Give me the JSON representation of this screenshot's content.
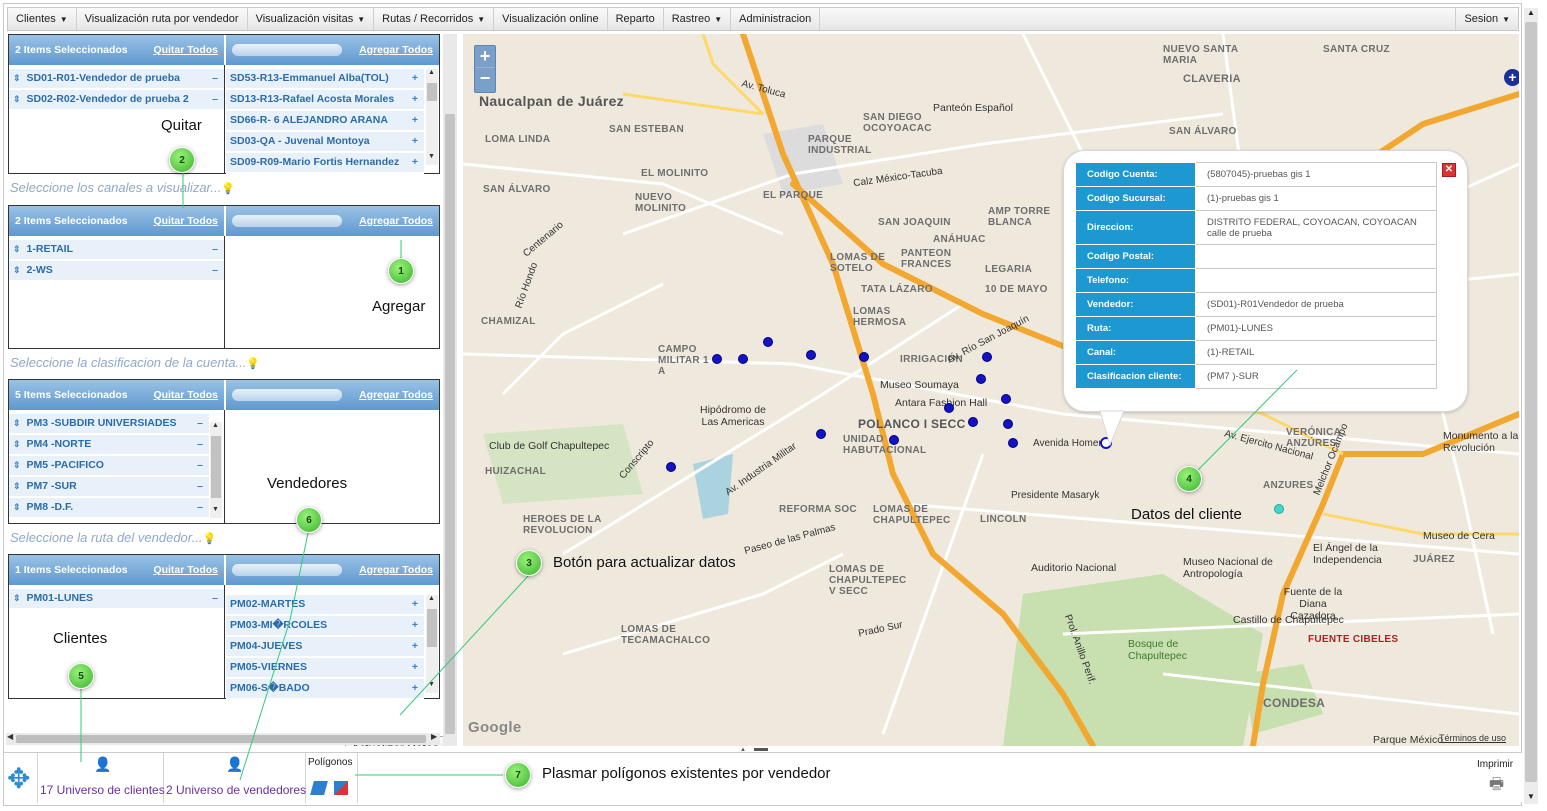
{
  "menu": {
    "items": [
      {
        "label": "Clientes",
        "caret": true
      },
      {
        "label": "Visualización ruta por vendedor",
        "caret": false
      },
      {
        "label": "Visualización visitas",
        "caret": true
      },
      {
        "label": "Rutas / Recorridos",
        "caret": true
      },
      {
        "label": "Visualización online",
        "caret": false
      },
      {
        "label": "Reparto",
        "caret": false
      },
      {
        "label": "Rastreo",
        "caret": true
      },
      {
        "label": "Administracion",
        "caret": false
      }
    ],
    "session": "Sesion"
  },
  "panel": {
    "box1": {
      "left_header": "2 Items Seleccionados",
      "remove_all": "Quitar Todos",
      "add_all": "Agregar Todos",
      "selected": [
        "SD01-R01-Vendedor de prueba",
        "SD02-R02-Vendedor de prueba 2"
      ],
      "available": [
        "SD53-R13-Emmanuel Alba(TOL)",
        "SD13-R13-Rafael Acosta Morales",
        "SD66-R- 6 ALEJANDRO ARANA",
        "SD03-QA - Juvenal Montoya",
        "SD09-R09-Mario Fortis Hernandez"
      ]
    },
    "hint_channels": "Seleccione los canales a visualizar...",
    "box2": {
      "left_header": "2 Items Seleccionados",
      "remove_all": "Quitar Todos",
      "add_all": "Agregar Todos",
      "selected": [
        "1-RETAIL",
        "2-WS"
      ]
    },
    "hint_class": "Seleccione la clasificacion de la cuenta...",
    "box3": {
      "left_header": "5 Items Seleccionados",
      "remove_all": "Quitar Todos",
      "add_all": "Agregar Todos",
      "selected": [
        "PM3 -SUBDIR UNIVERSIADES",
        "PM4 -NORTE",
        "PM5 -PACIFICO",
        "PM7 -SUR",
        "PM8 -D.F."
      ]
    },
    "hint_route": "Seleccione la ruta del vendedor...",
    "box4": {
      "left_header": "1 Items Seleccionados",
      "remove_all": "Quitar Todos",
      "add_all": "Agregar Todos",
      "selected": [
        "PM01-LUNES"
      ],
      "available": [
        "PM02-MARTES",
        "PM03-MI�RCOLES",
        "PM04-JUEVES",
        "PM05-VIERNES",
        "PM06-S�BADO"
      ]
    },
    "update_button": "Actualizar Datos",
    "minus": "–",
    "plus": "+"
  },
  "map": {
    "labels": [
      "Naucalpan de Juárez",
      "SAN ESTEBAN",
      "LOMA LINDA",
      "PARQUE INDUSTRIAL",
      "SAN DIEGO OCOYOACAC",
      "SAN ÁLVARO",
      "EL MOLINITO",
      "NUEVO MOLINITO",
      "EL PARQUE",
      "SAN JOAQUIN",
      "AMP TORRE BLANCA",
      "ANÁHUAC",
      "LOMAS DE SOTELO",
      "PANTEON FRANCES",
      "TATA LÁZARO",
      "LEGARIA",
      "10 DE MAYO",
      "LOMAS HERMOSA",
      "CHAMIZAL",
      "CAMPO MILITAR 1 A",
      "IRRIGACIÓN",
      "POLANCO I SECC",
      "UNIDAD HABUTACIONAL",
      "HUIZACHAL",
      "HEROES DE LA REVOLUCION",
      "REFORMA SOC",
      "LOMAS DE CHAPULTEPEC",
      "LOMAS DE CHAPULTEPEC V SECC",
      "LINCOLN",
      "ANZURES",
      "VERÓNICA ANZÚRES",
      "JUÁREZ",
      "CONDESA",
      "FUENTE CIBELES",
      "LOMAS DE TECAMACHALCO",
      "CLAVERÍA",
      "SANTA CRUZ",
      "NUEVO SANTA MARIA",
      "SAN ÁLVARO",
      "CLAVERIA"
    ],
    "pois": [
      "Panteón Español",
      "Hipódromo de Las Americas",
      "Museo Soumaya",
      "Antara Fashion Hall",
      "Club de Golf Chapultepec",
      "Auditorio Nacional",
      "Museo Nacional de Antropología",
      "Castillo de Chapultepec",
      "Bosque de Chapultepec",
      "Fuente de la Diana Cazadora",
      "El Ángel de la Independencia",
      "Museo de Cera",
      "Monumento a la Revolución",
      "Parque México"
    ],
    "streets": [
      "Av. Río San Joaquín",
      "Calz México-Tacuba",
      "Avenida Homero",
      "Presidente Masaryk",
      "Av. Industria Militar",
      "Prol. Anillo Perif.",
      "Melchor Ocampo",
      "Av. Ejercito Nacional",
      "Paseo de las Palmas",
      "Av. Toluca",
      "Conscripto",
      "Centenario",
      "Río Hondo",
      "Prado Sur"
    ],
    "attribution": "Términos de uso",
    "google": "Google"
  },
  "popup": {
    "rows": [
      {
        "k": "Codigo Cuenta:",
        "v": "(5807045)-pruebas gis 1"
      },
      {
        "k": "Codigo Sucursal:",
        "v": "(1)-pruebas gis 1"
      },
      {
        "k": "Direccion:",
        "v": "DISTRITO FEDERAL, COYOACAN, COYOACAN calle de prueba"
      },
      {
        "k": "Codigo Postal:",
        "v": ""
      },
      {
        "k": "Telefono:",
        "v": ""
      },
      {
        "k": "Vendedor:",
        "v": "(SD01)-R01Vendedor de prueba"
      },
      {
        "k": "Ruta:",
        "v": "(PM01)-LUNES"
      },
      {
        "k": "Canal:",
        "v": "(1)-RETAIL"
      },
      {
        "k": "Clasificacion cliente:",
        "v": "(PM7 )-SUR"
      }
    ]
  },
  "bottom": {
    "clients": "17 Universo de clientes",
    "sellers": "2 Universo de vendedores",
    "polygons": "Polígonos",
    "print": "Imprimir"
  },
  "annotations": {
    "quitar": "Quitar",
    "agregar": "Agregar",
    "vendedores": "Vendedores",
    "clientes": "Clientes",
    "boton": "Botón para actualizar datos",
    "datos": "Datos del cliente",
    "plasmar": "Plasmar polígonos existentes por vendedor",
    "badges": [
      "1",
      "2",
      "3",
      "4",
      "5",
      "6",
      "7"
    ]
  },
  "colors": {
    "header": "#5f98cf",
    "popup_key": "#1d98d1",
    "marker": "#1313c4",
    "badge": "#38b52d"
  }
}
